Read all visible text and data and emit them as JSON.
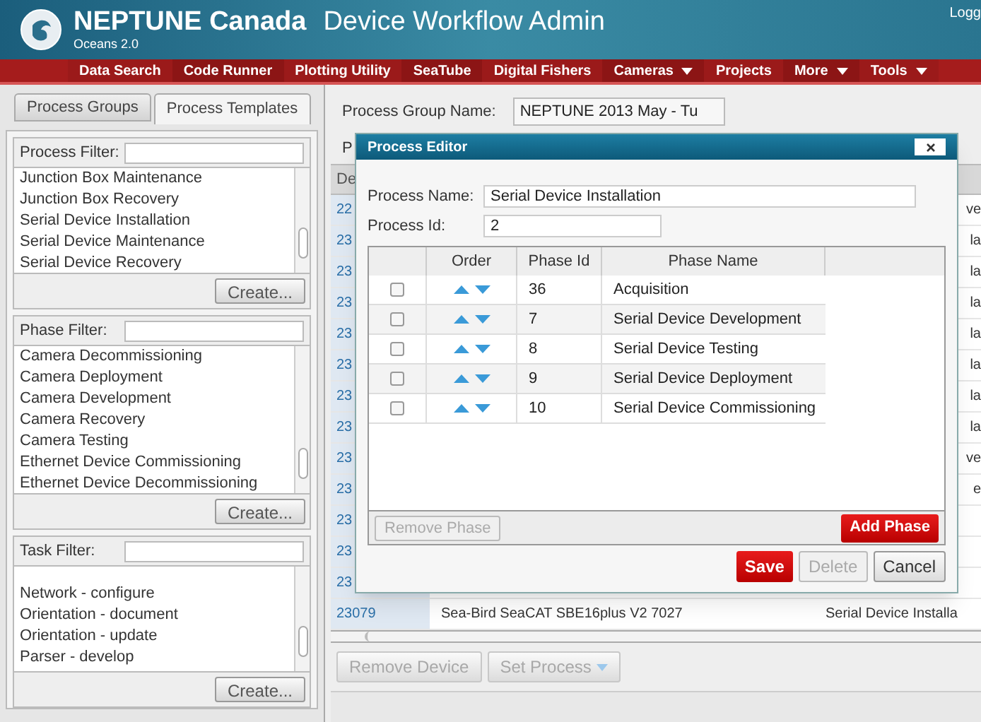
{
  "header": {
    "brand": "NEPTUNE Canada",
    "subbrand": "Oceans 2.0",
    "title": "Device Workflow Admin",
    "login": "Logg"
  },
  "nav": [
    {
      "label": "Data Search",
      "dropdown": false
    },
    {
      "label": "Code Runner",
      "dropdown": false
    },
    {
      "label": "Plotting Utility",
      "dropdown": false
    },
    {
      "label": "SeaTube",
      "dropdown": false
    },
    {
      "label": "Digital Fishers",
      "dropdown": false
    },
    {
      "label": "Cameras",
      "dropdown": true
    },
    {
      "label": "Projects",
      "dropdown": false
    },
    {
      "label": "More",
      "dropdown": true
    },
    {
      "label": "Tools",
      "dropdown": true
    }
  ],
  "tabs": [
    {
      "label": "Process Groups",
      "selected": false
    },
    {
      "label": "Process Templates",
      "selected": true
    }
  ],
  "sections": [
    {
      "filter_label": "Process Filter:",
      "items": [
        "Junction Box Maintenance",
        "Junction Box Recovery",
        "Serial Device Installation",
        "Serial Device Maintenance",
        "Serial Device Recovery"
      ],
      "button": "Create..."
    },
    {
      "filter_label": "Phase Filter:",
      "items": [
        "Camera Decommissioning",
        "Camera Deployment",
        "Camera Development",
        "Camera Recovery",
        "Camera Testing",
        "Ethernet Device Commissioning",
        "Ethernet Device Decommissioning"
      ],
      "button": "Create..."
    },
    {
      "filter_label": "Task Filter:",
      "items": [
        "Network - configure",
        "Orientation - document",
        "Orientation - update",
        "Parser - develop"
      ],
      "button": "Create..."
    }
  ],
  "main": {
    "group_name_label": "Process Group Name:",
    "group_name_value": "NEPTUNE 2013 May - Tu",
    "second_label": "P",
    "column_1": "De",
    "rows": [
      {
        "id": "22",
        "status": "ve"
      },
      {
        "id": "23",
        "status": "la"
      },
      {
        "id": "23",
        "status": "la"
      },
      {
        "id": "23",
        "status": "la"
      },
      {
        "id": "23",
        "status": "la"
      },
      {
        "id": "23",
        "status": "la"
      },
      {
        "id": "23",
        "status": "la"
      },
      {
        "id": "23",
        "status": "la"
      },
      {
        "id": "23",
        "status": "ve"
      },
      {
        "id": "23",
        "status": "e"
      },
      {
        "id": "23"
      },
      {
        "id": "23"
      },
      {
        "id": "23"
      },
      {
        "id": "23079",
        "device": "Sea-Bird SeaCAT SBE16plus V2 7027",
        "status": "Serial Device Installa"
      }
    ],
    "buttons": [
      {
        "label": "Remove Device",
        "disabled": true,
        "dropdown": false
      },
      {
        "label": "Set Process",
        "disabled": true,
        "dropdown": true
      }
    ]
  },
  "dialog": {
    "title": "Process Editor",
    "name_label": "Process Name:",
    "name_value": "Serial Device Installation",
    "id_label": "Process Id:",
    "id_value": "2",
    "columns": [
      "Order",
      "Phase Id",
      "Phase Name"
    ],
    "phases": [
      {
        "checked": false,
        "id": "36",
        "name": "Acquisition"
      },
      {
        "checked": false,
        "id": "7",
        "name": "Serial Device Development"
      },
      {
        "checked": false,
        "id": "8",
        "name": "Serial Device Testing"
      },
      {
        "checked": false,
        "id": "9",
        "name": "Serial Device Deployment"
      },
      {
        "checked": false,
        "id": "10",
        "name": "Serial Device Commissioning"
      }
    ],
    "remove_button": {
      "label": "Remove Phase",
      "disabled": true
    },
    "add_button": {
      "label": "Add Phase",
      "disabled": false
    },
    "footer_buttons": [
      {
        "label": "Save",
        "kind": "primary",
        "disabled": false
      },
      {
        "label": "Delete",
        "kind": "plain",
        "disabled": true
      },
      {
        "label": "Cancel",
        "kind": "plain",
        "disabled": false
      }
    ]
  }
}
